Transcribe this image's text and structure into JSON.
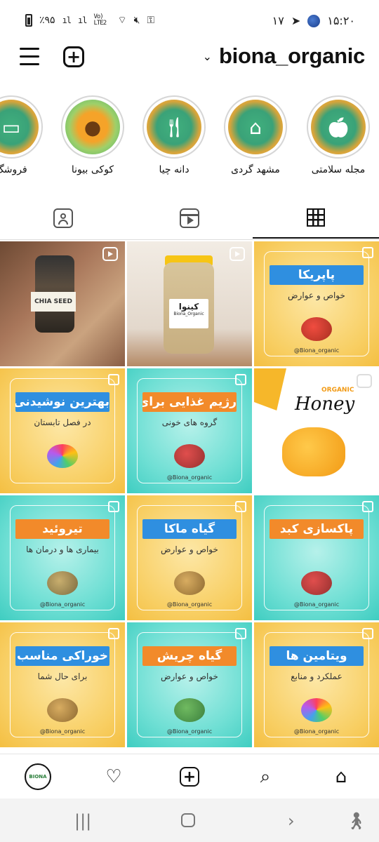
{
  "status_bar": {
    "time": "۱۵:۲۰",
    "notification_count": "۱۷",
    "battery_percent": "٪۹۵",
    "network": "Vo) LTE2"
  },
  "header": {
    "username": "biona_organic",
    "chevron_icon": "chevron-down-icon",
    "add_icon": "plus-square-icon",
    "menu_icon": "hamburger-menu-icon"
  },
  "highlights": [
    {
      "label": "مجله سلامتی",
      "icon": "apple-icon"
    },
    {
      "label": "مشهد گردی",
      "icon": "building-icon"
    },
    {
      "label": "دانه چیا",
      "icon": "plate-utensils-icon"
    },
    {
      "label": "کوکی بیونا",
      "icon": "cookie-icon"
    },
    {
      "label": "فروشگ",
      "icon": "for-sale-sign-icon"
    }
  ],
  "tabs": [
    {
      "name": "tagged",
      "icon": "person-tag-icon"
    },
    {
      "name": "reels",
      "icon": "reels-icon"
    },
    {
      "name": "grid",
      "icon": "grid-icon",
      "active": true
    }
  ],
  "posts": [
    {
      "kind": "photo-chia",
      "label": "CHIA SEED",
      "badge": "reel"
    },
    {
      "kind": "photo-quinoa",
      "label": "کینوا",
      "sub": "Biona_Organic",
      "badge": "reel"
    },
    {
      "kind": "card",
      "color": "yellow",
      "title": "پاپریکا",
      "title_color": "blue",
      "sub": "خواص و عوارض",
      "foot": "@Biona_organic",
      "illus": "red",
      "badge": "multi"
    },
    {
      "kind": "card",
      "color": "yellow",
      "title": "بهترین نوشیدنی ها",
      "title_color": "blue",
      "sub": "در فصل تابستان",
      "foot": "",
      "illus": "multi",
      "badge": "multi"
    },
    {
      "kind": "card",
      "color": "teal",
      "title": "رژیم غذایی برای",
      "title_color": "orange",
      "sub": "گروه های خونی",
      "foot": "@Biona_organic",
      "illus": "red",
      "badge": "multi"
    },
    {
      "kind": "honey",
      "title": "Honey",
      "sub": "ORGANIC",
      "badge": "reel"
    },
    {
      "kind": "card",
      "color": "teal",
      "title": "تیروئید",
      "title_color": "orange",
      "sub": "بیماری ها و درمان ها",
      "foot": "@Biona_organic",
      "illus": "gold",
      "badge": "multi"
    },
    {
      "kind": "card",
      "color": "yellow",
      "title": "گیاه ماکا",
      "title_color": "blue",
      "sub": "خواص و عوارض",
      "foot": "@Biona_organic",
      "illus": "gold",
      "badge": "multi"
    },
    {
      "kind": "card",
      "color": "teal",
      "title": "پاکسازی کبد",
      "title_color": "orange",
      "sub": "",
      "foot": "@Biona_organic",
      "illus": "red",
      "badge": "multi"
    },
    {
      "kind": "card",
      "color": "yellow",
      "title": "خوراکی مناسب",
      "title_color": "blue",
      "sub": "برای حال شما",
      "foot": "@Biona_organic",
      "illus": "gold",
      "badge": "multi"
    },
    {
      "kind": "card",
      "color": "teal",
      "title": "گیاه چریش",
      "title_color": "orange",
      "sub": "خواص و عوارض",
      "foot": "@Biona_organic",
      "illus": "green",
      "badge": "multi"
    },
    {
      "kind": "card",
      "color": "yellow",
      "title": "ویتامین ها",
      "title_color": "blue",
      "sub": "عملکرد و منابع",
      "foot": "@Biona_organic",
      "illus": "multi",
      "badge": "multi"
    }
  ],
  "bottom_nav": {
    "avatar_text": "BIONA",
    "items": [
      "profile-avatar",
      "heart-icon",
      "plus-square-icon",
      "search-icon",
      "home-icon"
    ]
  }
}
